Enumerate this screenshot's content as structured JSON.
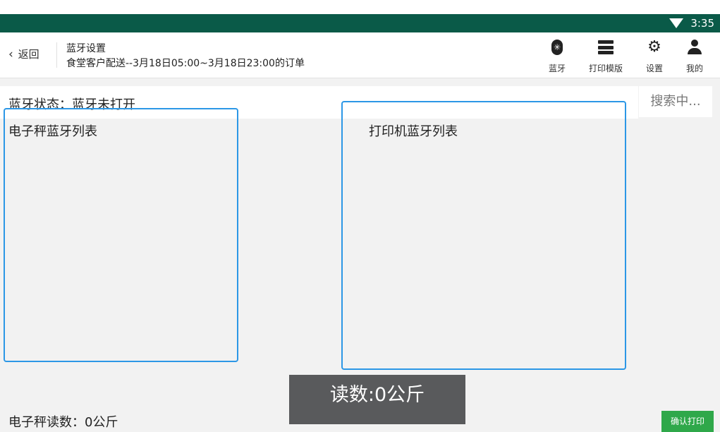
{
  "status_bar": {
    "time": "3:35",
    "wifi_icon": "wifi-icon"
  },
  "header": {
    "back_label": "返回",
    "title": "蓝牙设置",
    "subtitle": "食堂客户配送--3月18日05:00~3月18日23:00的订单",
    "nav": [
      {
        "label": "蓝牙",
        "icon": "bluetooth-icon"
      },
      {
        "label": "打印模版",
        "icon": "print-template-icon"
      },
      {
        "label": "设置",
        "icon": "gear-icon"
      },
      {
        "label": "我的",
        "icon": "user-icon"
      }
    ]
  },
  "bluetooth_status": "蓝牙状态：蓝牙未打开",
  "search_button": "搜索中...",
  "scale_list_title": "电子秤蓝牙列表",
  "printer_list_title": "打印机蓝牙列表",
  "scale_reading": "电子秤读数：0公斤",
  "toast_reading": "读数:0公斤",
  "green_button": "确认打印",
  "colors": {
    "status_bar": "#0a5a48",
    "panel_border": "#2c97e6",
    "toast_bg": "#595a5c",
    "green": "#2fa84a"
  }
}
